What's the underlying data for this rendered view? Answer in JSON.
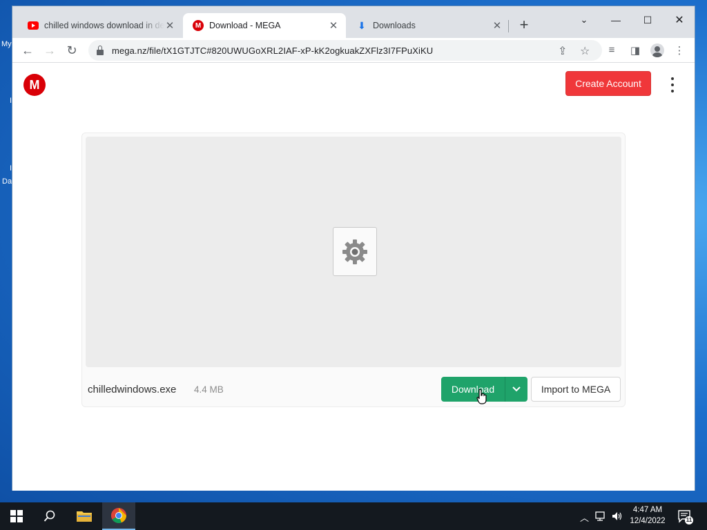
{
  "desktop": {
    "labels": [
      "My",
      "I",
      "I",
      "Da"
    ]
  },
  "browser": {
    "tabs": [
      {
        "title": "chilled windows download in de",
        "icon": "youtube-icon",
        "active": false
      },
      {
        "title": "Download - MEGA",
        "icon": "mega-icon",
        "active": true
      },
      {
        "title": "Downloads",
        "icon": "download-icon",
        "active": false
      }
    ],
    "url": "mega.nz/file/tX1GTJTC#820UWUGoXRL2IAF-xP-kK2ogkuakZXFlz3I7FPuXiKU"
  },
  "page": {
    "create_account_label": "Create Account",
    "logo_letter": "M",
    "file": {
      "name": "chilledwindows.exe",
      "size": "4.4 MB"
    },
    "download_label": "Download",
    "import_label": "Import to MEGA"
  },
  "taskbar": {
    "time": "4:47 AM",
    "date": "12/4/2022",
    "notification_count": "11"
  },
  "colors": {
    "mega_red": "#d90007",
    "create_button": "#f0373a",
    "download_green": "#1fa36a"
  }
}
